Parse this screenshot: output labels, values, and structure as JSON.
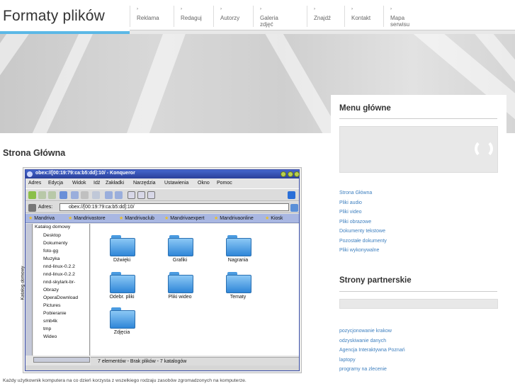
{
  "site": {
    "title": "Formaty plików"
  },
  "nav": {
    "items": [
      "Reklama",
      "Redaguj",
      "Autorzy",
      "Galeria zdjęć",
      "Znajdź",
      "Kontakt",
      "Mapa serwisu"
    ],
    "arrow": "›"
  },
  "content": {
    "title": "Strona Główna",
    "caption": "Każdy użytkownik komputera na co dzień korzysta z wszelkiego rodzaju zasobów zgromadzonych na komputerze."
  },
  "konqueror": {
    "window_title": "obex://[00:19:79:ca:b5:dd]:10/ - Konqueror",
    "menu": [
      "Adres",
      "Edycja",
      "Widok",
      "Idź",
      "Zakładki",
      "Narzędzia",
      "Ustawienia",
      "Okno",
      "Pomoc"
    ],
    "address_label": "Adres:",
    "address_value": "obex://[00:19:79:ca:b5:dd]:10/",
    "bookmarks": [
      "Mandriva",
      "Mandrivastore",
      "Mandrivaclub",
      "Mandrivaexpert",
      "Mandrivaonline",
      "Kiosk"
    ],
    "sidebar_tab": "Katalog domowy",
    "tree": [
      "Katalog domowy",
      "Desktop",
      "Dokumenty",
      "foto-gg",
      "Muzyka",
      "nnd-linux-0.2.2",
      "nnd-linux-0.2.2",
      "nnd-skylark-br-",
      "Obrazy",
      "OperaDownload",
      "Pictures",
      "Pobieranie",
      "smb4k",
      "tmp",
      "Wideo"
    ],
    "folders": [
      "Dźwięki",
      "Grafiki",
      "Nagrania",
      "Odebr. pliki",
      "Pliki wideo",
      "Tematy",
      "Zdjęcia"
    ],
    "status": "7 elementów - Brak plików - 7 katalogów"
  },
  "sidebar": {
    "menu_title": "Menu główne",
    "menu_links": [
      "Strona Główna",
      "Pliki audio",
      "Pliki video",
      "Pliki obrazowe",
      "Dokumenty tekstowe",
      "Pozostałe dokumenty",
      "Pliki wykonywalne"
    ],
    "partners_title": "Strony partnerskie",
    "partner_links": [
      "pozycjonowanie krakow",
      "odzyskiwanie danych",
      "Agencja Interaktywna Poznań",
      "laptopy",
      "programy na zlecenie"
    ]
  },
  "colors": {
    "accent": "#5cb8e6",
    "link": "#3d7fbf"
  }
}
